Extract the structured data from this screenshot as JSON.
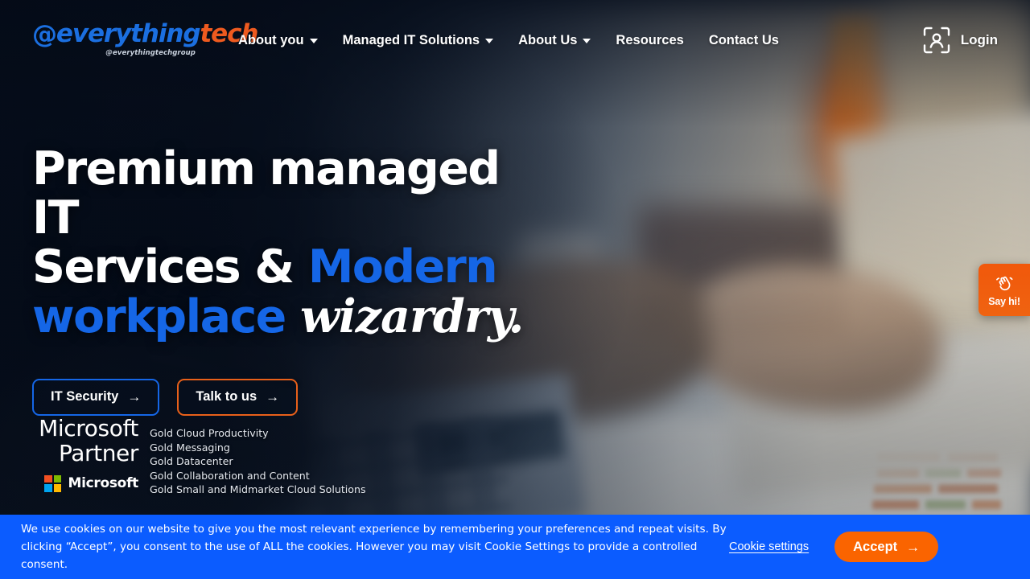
{
  "header": {
    "logo": {
      "at_symbol": "@",
      "name_part1": "everything",
      "name_part2": "tech",
      "tagline": "@everythingtechgroup"
    },
    "nav": [
      {
        "label": "About you",
        "has_dropdown": true
      },
      {
        "label": "Managed IT Solutions",
        "has_dropdown": true
      },
      {
        "label": "About Us",
        "has_dropdown": true
      },
      {
        "label": "Resources",
        "has_dropdown": false
      },
      {
        "label": "Contact Us",
        "has_dropdown": false
      }
    ],
    "login": {
      "label": "Login",
      "icon": "user-scan-icon"
    }
  },
  "hero": {
    "headline": {
      "line1": "Premium managed IT",
      "line2_white": "Services & ",
      "line2_blue": "Modern",
      "line3_blue": "workplace ",
      "line3_italic": "wizardry."
    },
    "buttons": [
      {
        "label": "IT Security",
        "arrow": "→",
        "style": "blue-outline"
      },
      {
        "label": "Talk to us",
        "arrow": "→",
        "style": "orange-outline"
      }
    ]
  },
  "partner_badge": {
    "line1": "Microsoft",
    "line2": "Partner",
    "microsoft_mark": "Microsoft",
    "competencies": [
      "Gold Cloud Productivity",
      "Gold Messaging",
      "Gold Datacenter",
      "Gold Collaboration and Content",
      "Gold Small and Midmarket Cloud Solutions"
    ]
  },
  "chat_widget": {
    "label": "Say hi!",
    "icon": "waving-hand-icon"
  },
  "cookie_banner": {
    "message": "We use cookies on our website to give you the most relevant experience by remembering your preferences and repeat visits. By clicking “Accept”, you consent to the use of ALL the cookies. However you may visit Cookie Settings to provide a controlled consent.",
    "settings_label": "Cookie settings",
    "accept_label": "Accept",
    "accept_arrow": "→"
  },
  "colors": {
    "brand_blue": "#1566E6",
    "brand_orange": "#EE5A1F",
    "cookie_banner_blue": "#0B5CFF",
    "accept_orange": "#FA6400",
    "chat_orange": "#F1580B",
    "hero_dark": "#050C18"
  }
}
